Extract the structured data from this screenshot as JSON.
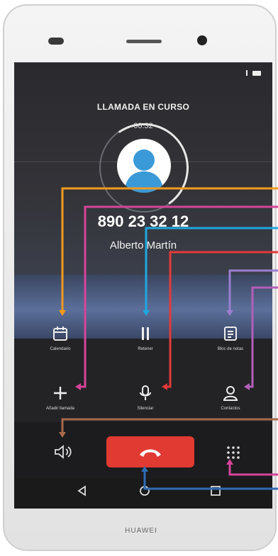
{
  "status_bar": {
    "signal": "signal-icon",
    "battery": "battery-icon"
  },
  "call": {
    "title": "LLAMADA EN CURSO",
    "timer": "00:32",
    "number": "890 23 32 12",
    "name": "Alberto Martín"
  },
  "actions_row1": [
    {
      "label": "Calendario",
      "icon": "calendar-icon"
    },
    {
      "label": "Retener",
      "icon": "pause-icon"
    },
    {
      "label": "Bloc de notas",
      "icon": "notes-icon"
    }
  ],
  "actions_row2": [
    {
      "label": "Añadir llamada",
      "icon": "plus-icon"
    },
    {
      "label": "Silenciar",
      "icon": "microphone-icon"
    },
    {
      "label": "Contactos",
      "icon": "contacts-icon"
    }
  ],
  "bottom_controls": {
    "speaker": "speaker-icon",
    "end_call": "end-call-icon",
    "dialpad": "dialpad-icon"
  },
  "nav": {
    "back": "back-icon",
    "home": "home-icon",
    "recent": "recent-apps-icon"
  },
  "brand": "HUAWEI",
  "callout_colors": {
    "calendar": "#f39a1e",
    "add_call": "#d6449a",
    "hold": "#1fa8e0",
    "mute": "#e33a3a",
    "notes": "#9b7fd0",
    "contacts": "#b35fb8",
    "speaker": "#a86a4c",
    "dialpad": "#d6449a",
    "end_call": "#2f6db3"
  }
}
